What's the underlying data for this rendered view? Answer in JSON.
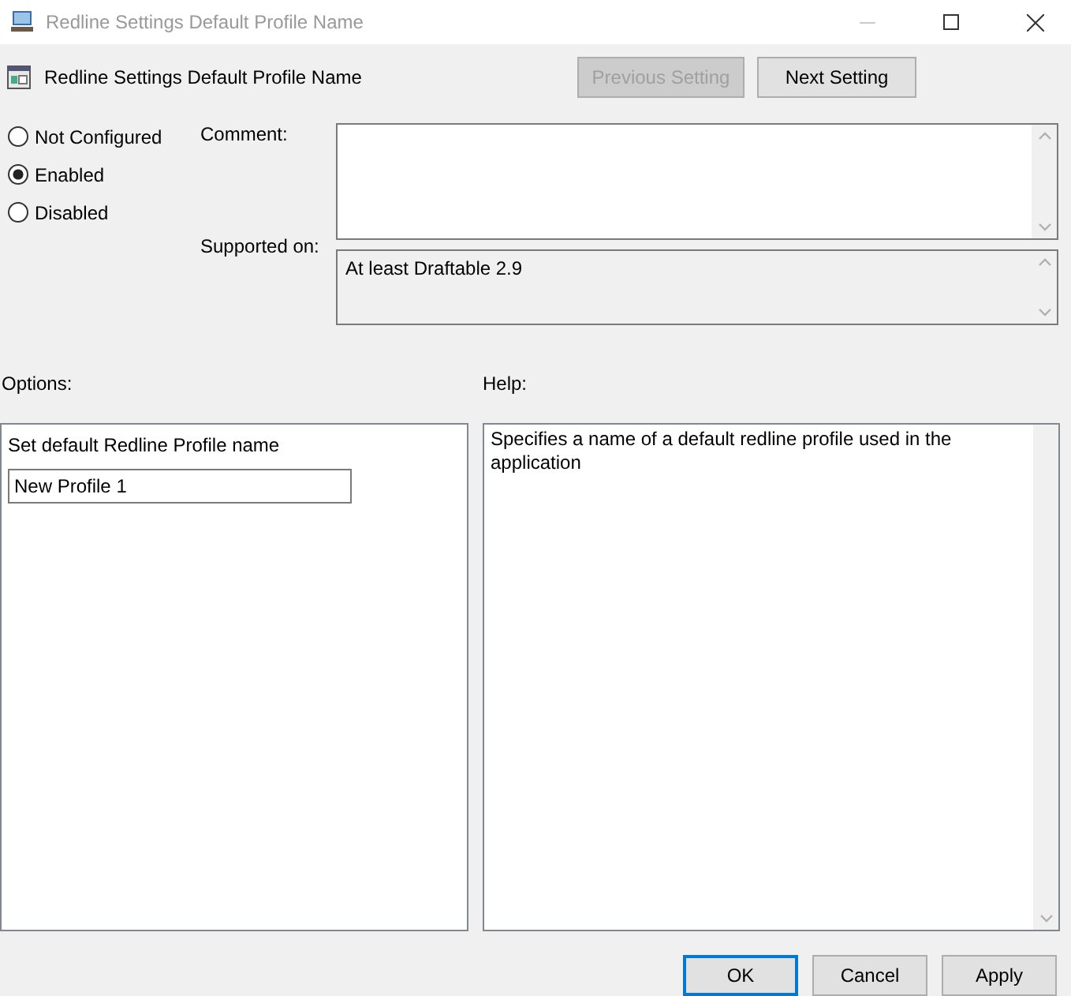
{
  "window": {
    "title": "Redline Settings Default Profile Name"
  },
  "header": {
    "title": "Redline Settings Default Profile Name"
  },
  "nav_buttons": [
    {
      "label": "Previous Setting",
      "disabled": true
    },
    {
      "label": "Next Setting",
      "disabled": false
    }
  ],
  "state_options": [
    {
      "label": "Not Configured",
      "selected": false
    },
    {
      "label": "Enabled",
      "selected": true
    },
    {
      "label": "Disabled",
      "selected": false
    }
  ],
  "comment": {
    "label": "Comment:"
  },
  "supported_on": {
    "label": "Supported on:",
    "value": "At least Draftable 2.9"
  },
  "options": {
    "label": "Options:",
    "field_label": "Set default Redline Profile name",
    "value": "New Profile 1"
  },
  "help": {
    "label": "Help:",
    "text": "Specifies a name of a default redline profile used in the application"
  },
  "buttons": [
    {
      "label": "OK",
      "default": true
    },
    {
      "label": "Cancel",
      "default": false
    },
    {
      "label": "Apply",
      "default": false
    }
  ]
}
